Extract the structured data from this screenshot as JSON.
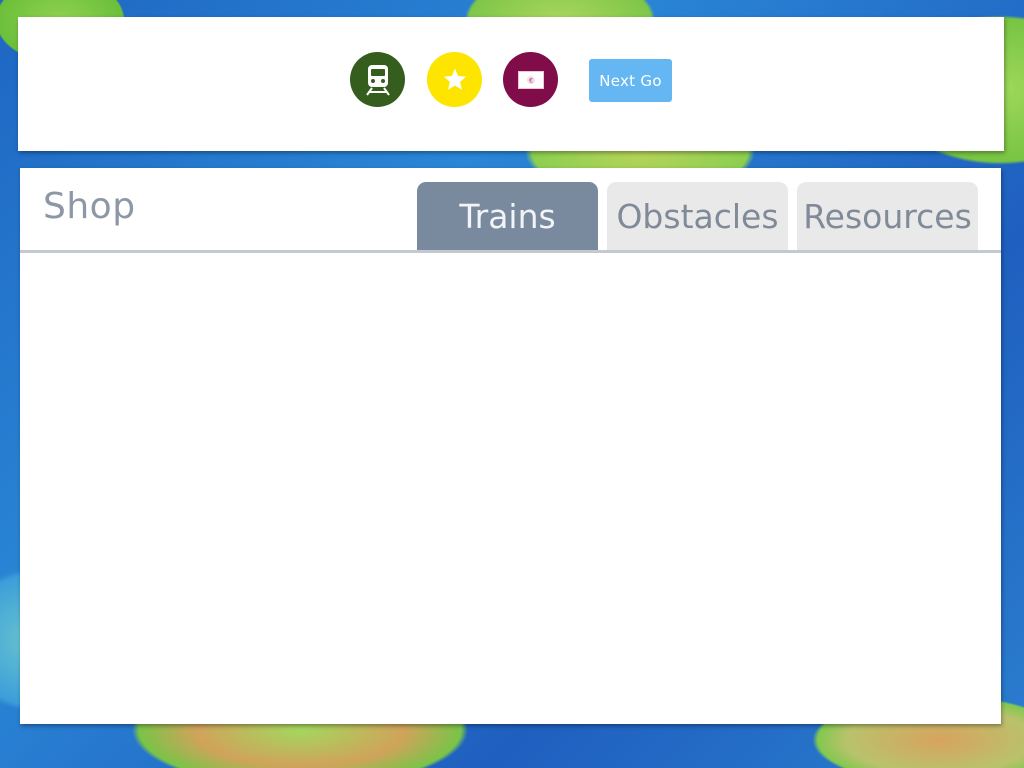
{
  "toolbar": {
    "buttons": [
      {
        "name": "trains",
        "icon": "train-icon",
        "color": "#355e1e"
      },
      {
        "name": "score",
        "icon": "star-icon",
        "color": "#fde500"
      },
      {
        "name": "money",
        "icon": "banknote-icon",
        "color": "#800d4a"
      }
    ],
    "next_label": "Next Go"
  },
  "shop": {
    "title": "Shop",
    "tabs": [
      {
        "label": "Trains",
        "active": true
      },
      {
        "label": "Obstacles",
        "active": false
      },
      {
        "label": "Resources",
        "active": false
      }
    ]
  }
}
